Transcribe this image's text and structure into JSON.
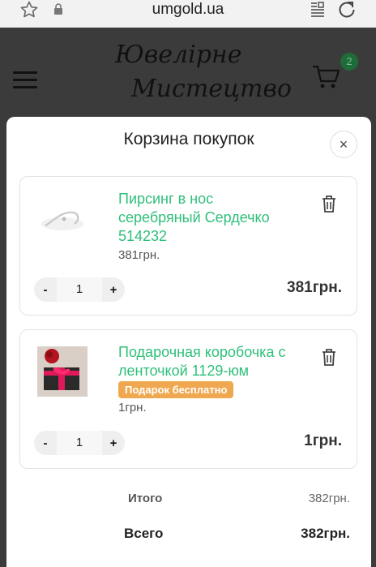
{
  "browser": {
    "url": "umgold.ua",
    "icons": [
      "star-icon",
      "lock-icon",
      "reader-icon",
      "reload-icon"
    ]
  },
  "header": {
    "logo_line1": "Ювелірне",
    "logo_line2": "Мистецтво",
    "cart_count": "2",
    "accent_color": "#1f6b3a"
  },
  "cart": {
    "title": "Корзина покупок",
    "close_label": "×",
    "items": [
      {
        "name": "Пирсинг в нос серебряный Сердечко 514232",
        "unit_price": "381грн.",
        "qty": "1",
        "minus": "-",
        "plus": "+",
        "line_total": "381грн.",
        "badge": ""
      },
      {
        "name": "Подарочная коробочка с ленточкой 1129-юм",
        "unit_price": "1грн.",
        "qty": "1",
        "minus": "-",
        "plus": "+",
        "line_total": "1грн.",
        "badge": "Подарок бесплатно"
      }
    ],
    "subtotal_label": "Итого",
    "subtotal_value": "382грн.",
    "total_label": "Всего",
    "total_value": "382грн.",
    "name_color": "#2fbf7a",
    "badge_color": "#f0a850"
  }
}
